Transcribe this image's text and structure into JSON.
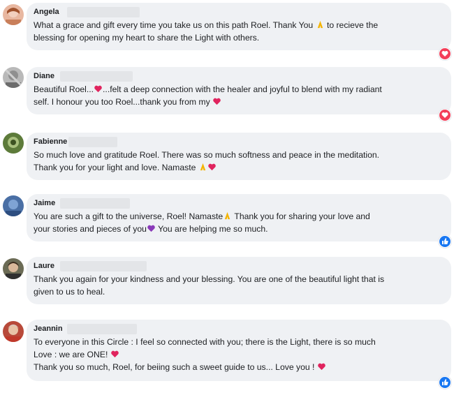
{
  "comments": [
    {
      "name": "Angela",
      "lines": [
        "What a grace and gift every time you take us on this path Roel. Thank You",
        "to recieve the",
        "blessing for opening my heart to share the Light with others."
      ],
      "reaction": "heart-icon"
    },
    {
      "name": "Diane",
      "lines": [
        "Beautiful Roel...",
        "...felt a deep connection with the healer and joyful to blend with my radiant",
        "self. I honour you too Roel...thank you from my"
      ],
      "reaction": "heart-icon"
    },
    {
      "name": "Fabienne",
      "lines": [
        "So much love and gratitude Roel. There was so much softness and peace in the meditation.",
        "Thank you for your light and love. Namaste"
      ]
    },
    {
      "name": "Jaime",
      "lines": [
        "You are such a gift to the universe, Roel! Namaste",
        "Thank you for sharing your love and",
        "your stories and pieces of you",
        "You are helping me so much."
      ],
      "reaction": "like-icon"
    },
    {
      "name": "Laure",
      "lines": [
        "Thank you again for your kindness and your blessing. You are one of the beautiful light that is",
        "given to us to heal."
      ]
    },
    {
      "name": "Jeannin",
      "lines": [
        "To everyone in this Circle : I feel so connected with you; there is the Light, there is so much",
        "Love : we are ONE!",
        "Thank you so much, Roel, for beiing such a sweet guide to us... Love you !"
      ],
      "reaction": "like-icon"
    }
  ],
  "colors": {
    "bubble": "#eff1f4",
    "heart_reaction": "#f33e58",
    "like_reaction": "#1877f2",
    "emoji_heart": "#e0245e",
    "emoji_purple_heart": "#8a3ab9",
    "emoji_prayer": "#f4b400"
  }
}
